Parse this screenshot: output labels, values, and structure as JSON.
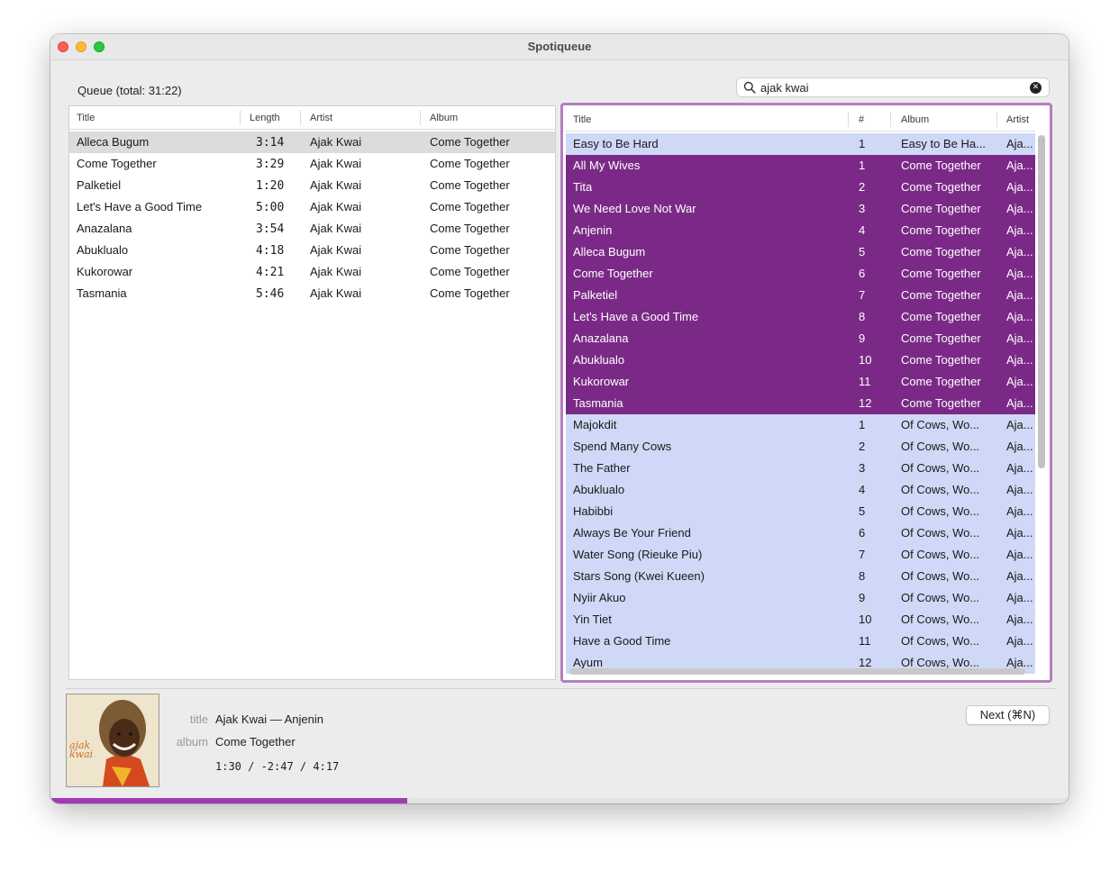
{
  "window": {
    "title": "Spotiqueue"
  },
  "queue": {
    "label": "Queue (total: 31:22)",
    "columns": [
      "Title",
      "Length",
      "Artist",
      "Album"
    ],
    "rows": [
      {
        "title": "Alleca Bugum",
        "length": "3:14",
        "artist": "Ajak Kwai",
        "album": "Come Together",
        "selected": true
      },
      {
        "title": "Come Together",
        "length": "3:29",
        "artist": "Ajak Kwai",
        "album": "Come Together",
        "selected": false
      },
      {
        "title": "Palketiel",
        "length": "1:20",
        "artist": "Ajak Kwai",
        "album": "Come Together",
        "selected": false
      },
      {
        "title": "Let's Have a Good Time",
        "length": "5:00",
        "artist": "Ajak Kwai",
        "album": "Come Together",
        "selected": false
      },
      {
        "title": "Anazalana",
        "length": "3:54",
        "artist": "Ajak Kwai",
        "album": "Come Together",
        "selected": false
      },
      {
        "title": "Abuklualo",
        "length": "4:18",
        "artist": "Ajak Kwai",
        "album": "Come Together",
        "selected": false
      },
      {
        "title": "Kukorowar",
        "length": "4:21",
        "artist": "Ajak Kwai",
        "album": "Come Together",
        "selected": false
      },
      {
        "title": "Tasmania",
        "length": "5:46",
        "artist": "Ajak Kwai",
        "album": "Come Together",
        "selected": false
      }
    ]
  },
  "search": {
    "value": "ajak kwai",
    "icon": "magnifier",
    "clear_icon": "clear",
    "clear_glyph": "✕"
  },
  "results": {
    "columns": [
      "Title",
      "#",
      "Album",
      "Artist"
    ],
    "rows": [
      {
        "title": "Easy to Be Hard",
        "num": "1",
        "album": "Easy to Be Ha...",
        "artist": "Aja...",
        "highlighted": false
      },
      {
        "title": "All My Wives",
        "num": "1",
        "album": "Come Together",
        "artist": "Aja...",
        "highlighted": true
      },
      {
        "title": "Tita",
        "num": "2",
        "album": "Come Together",
        "artist": "Aja...",
        "highlighted": true
      },
      {
        "title": "We Need Love Not War",
        "num": "3",
        "album": "Come Together",
        "artist": "Aja...",
        "highlighted": true
      },
      {
        "title": "Anjenin",
        "num": "4",
        "album": "Come Together",
        "artist": "Aja...",
        "highlighted": true
      },
      {
        "title": "Alleca Bugum",
        "num": "5",
        "album": "Come Together",
        "artist": "Aja...",
        "highlighted": true
      },
      {
        "title": "Come Together",
        "num": "6",
        "album": "Come Together",
        "artist": "Aja...",
        "highlighted": true
      },
      {
        "title": "Palketiel",
        "num": "7",
        "album": "Come Together",
        "artist": "Aja...",
        "highlighted": true
      },
      {
        "title": "Let's Have a Good Time",
        "num": "8",
        "album": "Come Together",
        "artist": "Aja...",
        "highlighted": true
      },
      {
        "title": "Anazalana",
        "num": "9",
        "album": "Come Together",
        "artist": "Aja...",
        "highlighted": true
      },
      {
        "title": "Abuklualo",
        "num": "10",
        "album": "Come Together",
        "artist": "Aja...",
        "highlighted": true
      },
      {
        "title": "Kukorowar",
        "num": "11",
        "album": "Come Together",
        "artist": "Aja...",
        "highlighted": true
      },
      {
        "title": "Tasmania",
        "num": "12",
        "album": "Come Together",
        "artist": "Aja...",
        "highlighted": true
      },
      {
        "title": "Majokdit",
        "num": "1",
        "album": "Of Cows, Wo...",
        "artist": "Aja...",
        "highlighted": false
      },
      {
        "title": "Spend Many Cows",
        "num": "2",
        "album": "Of Cows, Wo...",
        "artist": "Aja...",
        "highlighted": false
      },
      {
        "title": "The Father",
        "num": "3",
        "album": "Of Cows, Wo...",
        "artist": "Aja...",
        "highlighted": false
      },
      {
        "title": "Abuklualo",
        "num": "4",
        "album": "Of Cows, Wo...",
        "artist": "Aja...",
        "highlighted": false
      },
      {
        "title": "Habibbi",
        "num": "5",
        "album": "Of Cows, Wo...",
        "artist": "Aja...",
        "highlighted": false
      },
      {
        "title": "Always Be Your Friend",
        "num": "6",
        "album": "Of Cows, Wo...",
        "artist": "Aja...",
        "highlighted": false
      },
      {
        "title": "Water Song (Rieuke Piu)",
        "num": "7",
        "album": "Of Cows, Wo...",
        "artist": "Aja...",
        "highlighted": false
      },
      {
        "title": "Stars Song (Kwei Kueen)",
        "num": "8",
        "album": "Of Cows, Wo...",
        "artist": "Aja...",
        "highlighted": false
      },
      {
        "title": "Nyiir Akuo",
        "num": "9",
        "album": "Of Cows, Wo...",
        "artist": "Aja...",
        "highlighted": false
      },
      {
        "title": "Yin Tiet",
        "num": "10",
        "album": "Of Cows, Wo...",
        "artist": "Aja...",
        "highlighted": false
      },
      {
        "title": "Have a Good Time",
        "num": "11",
        "album": "Of Cows, Wo...",
        "artist": "Aja...",
        "highlighted": false
      },
      {
        "title": "Ayum",
        "num": "12",
        "album": "Of Cows, Wo...",
        "artist": "Aja...",
        "highlighted": false
      }
    ]
  },
  "now_playing": {
    "title_label": "title",
    "title_value": "Ajak Kwai — Anjenin",
    "album_label": "album",
    "album_value": "Come Together",
    "time": "1:30 / -2:47 / 4:17",
    "cover_text": "ajak kwai",
    "progress_fraction": 0.35
  },
  "controls": {
    "next_label": "Next (⌘N)"
  },
  "colors": {
    "highlight": "#7a2a86",
    "result_row": "#cfd8f6",
    "focus_ring": "#b57ebf",
    "progress": "#a33ab5"
  }
}
